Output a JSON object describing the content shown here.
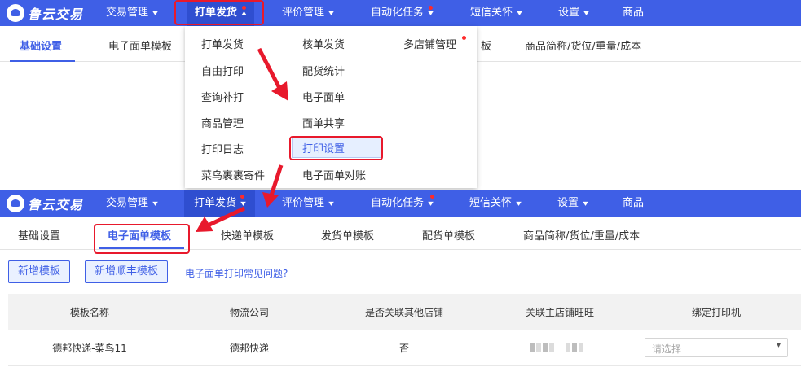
{
  "app": {
    "name": "鲁云交易"
  },
  "top_nav": [
    {
      "label": "交易管理",
      "chevron": "▾",
      "dot": false
    },
    {
      "label": "打单发货",
      "chevron": "▴",
      "dot": true
    },
    {
      "label": "评价管理",
      "chevron": "▾",
      "dot": false
    },
    {
      "label": "自动化任务",
      "chevron": "▾",
      "dot": true
    },
    {
      "label": "短信关怀",
      "chevron": "▾",
      "dot": false
    },
    {
      "label": "设置",
      "chevron": "▾",
      "dot": false
    },
    {
      "label": "商品",
      "chevron": "",
      "dot": false
    }
  ],
  "top_nav_2": [
    {
      "label": "交易管理",
      "chevron": "▾"
    },
    {
      "label": "打单发货",
      "chevron": "▾"
    },
    {
      "label": "评价管理",
      "chevron": "▾"
    },
    {
      "label": "自动化任务",
      "chevron": "▾"
    },
    {
      "label": "短信关怀",
      "chevron": "▾"
    },
    {
      "label": "设置",
      "chevron": "▾"
    },
    {
      "label": "商品",
      "chevron": ""
    }
  ],
  "subnav_1": {
    "tabs": [
      "基础设置",
      "电子面单模板",
      "板",
      "商品简称/货位/重量/成本"
    ],
    "active": "基础设置"
  },
  "dropdown": {
    "col1": [
      "打单发货",
      "自由打印",
      "查询补打",
      "商品管理",
      "打印日志",
      "菜鸟裹裹寄件"
    ],
    "col2": [
      "核单发货",
      "配货统计",
      "电子面单",
      "面单共享",
      "打印设置",
      "电子面单对账"
    ],
    "col3": [
      "多店铺管理"
    ],
    "selected": "打印设置"
  },
  "subnav_2": {
    "tabs": [
      "基础设置",
      "电子面单模板",
      "快递单模板",
      "发货单模板",
      "配货单模板",
      "商品简称/货位/重量/成本"
    ],
    "active": "电子面单模板"
  },
  "toolbar": {
    "add_template": "新增模板",
    "add_sf_template": "新增顺丰模板",
    "help_link": "电子面单打印常见问题?"
  },
  "table": {
    "headers": [
      "模板名称",
      "物流公司",
      "是否关联其他店铺",
      "关联主店铺旺旺",
      "绑定打印机"
    ],
    "rows": [
      {
        "name": "德邦快递-菜鸟11",
        "carrier": "德邦快递",
        "linked": "否",
        "printer_placeholder": "请选择"
      }
    ]
  },
  "colors": {
    "nav_bg": "#3f5fe6",
    "accent": "#3f5fe6",
    "annotation": "#e8192c"
  },
  "icons": {
    "dropdown_caret": "▾"
  }
}
